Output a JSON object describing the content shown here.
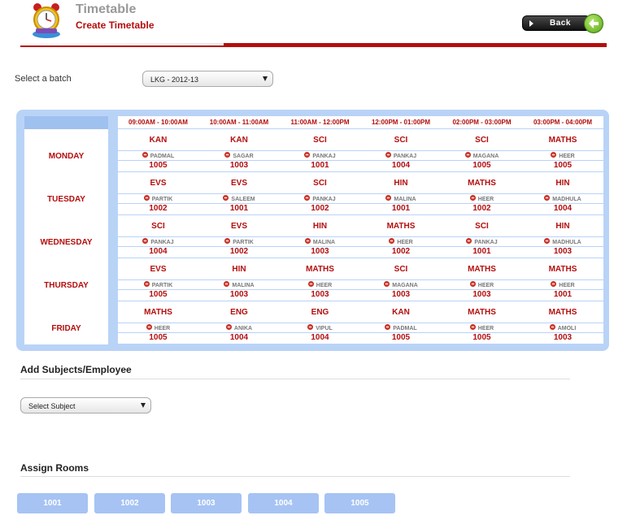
{
  "header": {
    "title": "Timetable",
    "subtitle": "Create Timetable",
    "back_label": "Back",
    "logo_icon": "alarm-clock-icon",
    "accent_color": "#b40d0d"
  },
  "batch": {
    "label": "Select a batch",
    "selected": "LKG - 2012-13"
  },
  "timetable": {
    "times": [
      "09:00AM - 10:00AM",
      "10:00AM - 11:00AM",
      "11:00AM - 12:00PM",
      "12:00PM - 01:00PM",
      "02:00PM - 03:00PM",
      "03:00PM - 04:00PM"
    ],
    "days": [
      {
        "name": "MONDAY",
        "slots": [
          {
            "subject": "KAN",
            "employee": "PADMAL",
            "room": "1005"
          },
          {
            "subject": "KAN",
            "employee": "SAGAR",
            "room": "1003"
          },
          {
            "subject": "SCI",
            "employee": "PANKAJ",
            "room": "1001"
          },
          {
            "subject": "SCI",
            "employee": "PANKAJ",
            "room": "1004"
          },
          {
            "subject": "SCI",
            "employee": "MAGANA",
            "room": "1005"
          },
          {
            "subject": "MATHS",
            "employee": "HEER",
            "room": "1005"
          }
        ]
      },
      {
        "name": "TUESDAY",
        "slots": [
          {
            "subject": "EVS",
            "employee": "PARTIK",
            "room": "1002"
          },
          {
            "subject": "EVS",
            "employee": "SALEEM",
            "room": "1001"
          },
          {
            "subject": "SCI",
            "employee": "PANKAJ",
            "room": "1002"
          },
          {
            "subject": "HIN",
            "employee": "MALINA",
            "room": "1001"
          },
          {
            "subject": "MATHS",
            "employee": "HEER",
            "room": "1002"
          },
          {
            "subject": "HIN",
            "employee": "MADHULA",
            "room": "1004"
          }
        ]
      },
      {
        "name": "WEDNESDAY",
        "slots": [
          {
            "subject": "SCI",
            "employee": "PANKAJ",
            "room": "1004"
          },
          {
            "subject": "EVS",
            "employee": "PARTIK",
            "room": "1002"
          },
          {
            "subject": "HIN",
            "employee": "MALINA",
            "room": "1003"
          },
          {
            "subject": "MATHS",
            "employee": "HEER",
            "room": "1002"
          },
          {
            "subject": "SCI",
            "employee": "PANKAJ",
            "room": "1001"
          },
          {
            "subject": "HIN",
            "employee": "MADHULA",
            "room": "1003"
          }
        ]
      },
      {
        "name": "THURSDAY",
        "slots": [
          {
            "subject": "EVS",
            "employee": "PARTIK",
            "room": "1005"
          },
          {
            "subject": "HIN",
            "employee": "MALINA",
            "room": "1003"
          },
          {
            "subject": "MATHS",
            "employee": "HEER",
            "room": "1003"
          },
          {
            "subject": "SCI",
            "employee": "MAGANA",
            "room": "1003"
          },
          {
            "subject": "MATHS",
            "employee": "HEER",
            "room": "1003"
          },
          {
            "subject": "MATHS",
            "employee": "HEER",
            "room": "1001"
          }
        ]
      },
      {
        "name": "FRIDAY",
        "slots": [
          {
            "subject": "MATHS",
            "employee": "HEER",
            "room": "1005"
          },
          {
            "subject": "ENG",
            "employee": "ANIKA",
            "room": "1004"
          },
          {
            "subject": "ENG",
            "employee": "VIPUL",
            "room": "1004"
          },
          {
            "subject": "KAN",
            "employee": "PADMAL",
            "room": "1005"
          },
          {
            "subject": "MATHS",
            "employee": "HEER",
            "room": "1005"
          },
          {
            "subject": "MATHS",
            "employee": "AMOLI",
            "room": "1003"
          }
        ]
      }
    ]
  },
  "add_subjects": {
    "title": "Add Subjects/Employee",
    "select_placeholder": "Select Subject"
  },
  "assign_rooms": {
    "title": "Assign Rooms",
    "rooms": [
      "1001",
      "1002",
      "1003",
      "1004",
      "1005"
    ]
  }
}
